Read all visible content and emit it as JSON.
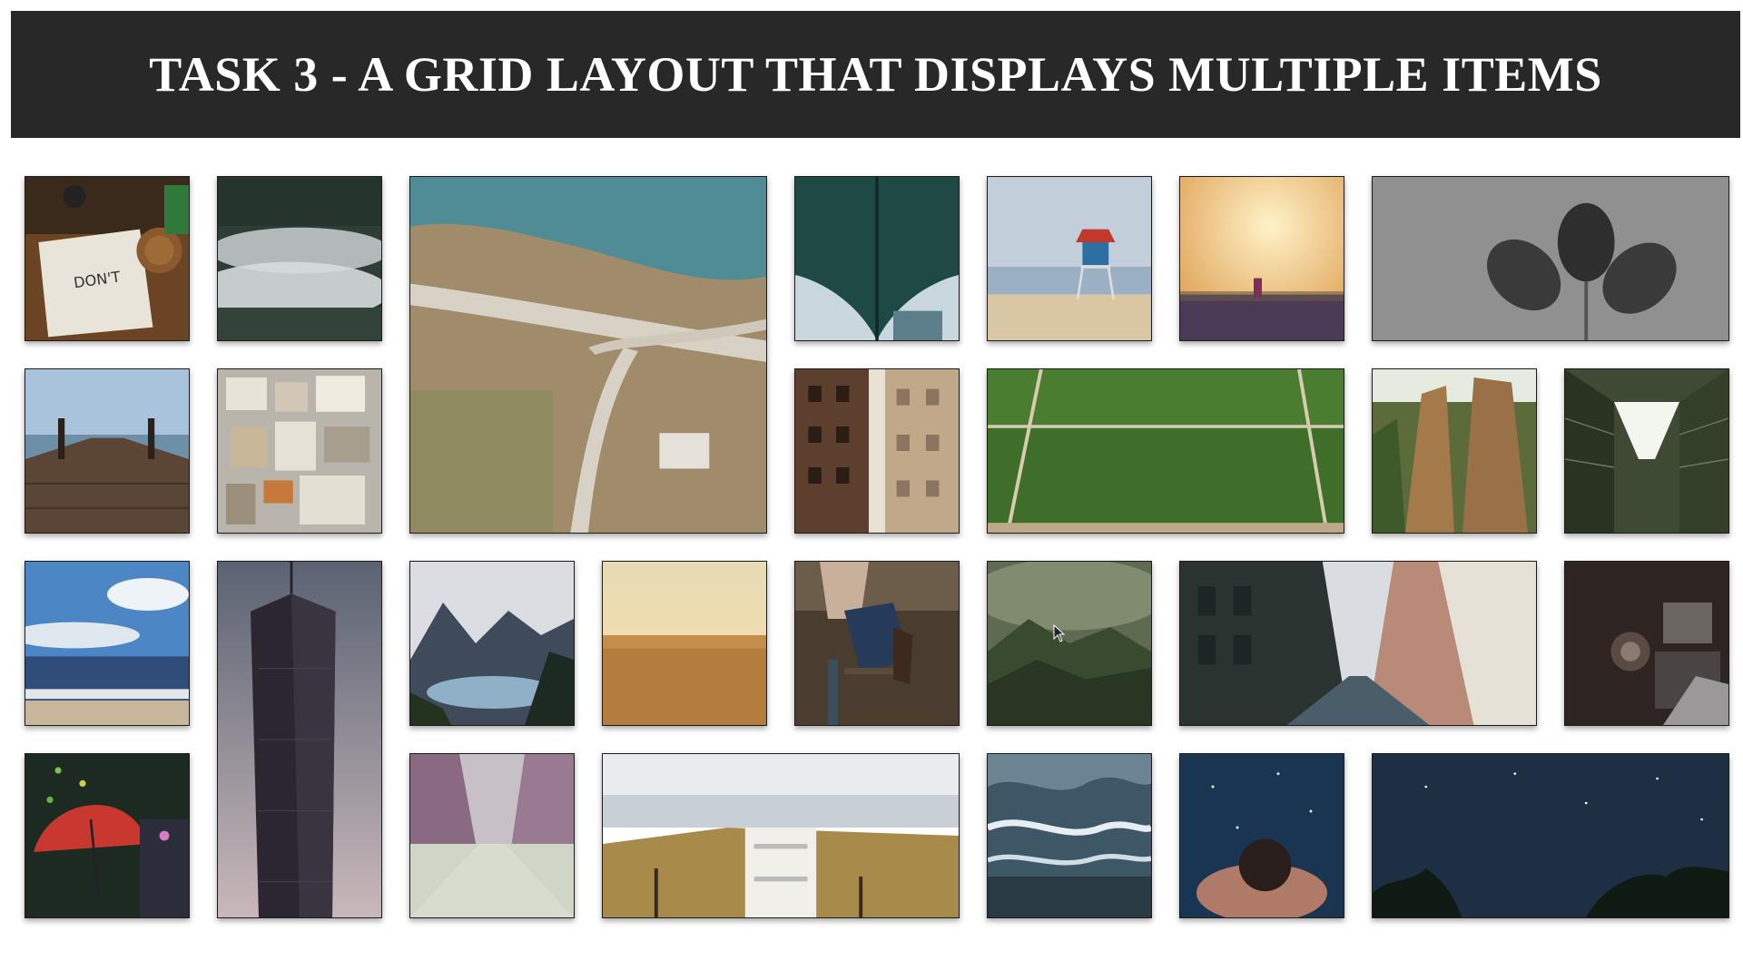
{
  "header": {
    "title": "TASK 3 - A GRID LAYOUT THAT DISPLAYS MULTIPLE ITEMS"
  },
  "grid": {
    "tiles": [
      {
        "subject": "desk with notebook"
      },
      {
        "subject": "foggy forest"
      },
      {
        "subject": "highway interchange aerial"
      },
      {
        "subject": "bridge underside"
      },
      {
        "subject": "lifeguard tower on beach"
      },
      {
        "subject": "sunset field with runner"
      },
      {
        "subject": "pine cones"
      },
      {
        "subject": "pier with ropes"
      },
      {
        "subject": "city houses aerial"
      },
      {
        "subject": "building fire escapes"
      },
      {
        "subject": "grass sports field"
      },
      {
        "subject": "rock cliffs"
      },
      {
        "subject": "looking up courtyard"
      },
      {
        "subject": "ocean beach"
      },
      {
        "subject": "skyscraper"
      },
      {
        "subject": "mountain lake"
      },
      {
        "subject": "desert horizon"
      },
      {
        "subject": "person sitting on stool"
      },
      {
        "subject": "misty forest hills"
      },
      {
        "subject": "city street"
      },
      {
        "subject": "vintage projector"
      },
      {
        "subject": "red umbrella at night"
      },
      {
        "subject": "misty tree road"
      },
      {
        "subject": "lifeguard chair on dunes"
      },
      {
        "subject": "ocean waves"
      },
      {
        "subject": "person in water at night"
      },
      {
        "subject": "starry night sky"
      }
    ]
  }
}
